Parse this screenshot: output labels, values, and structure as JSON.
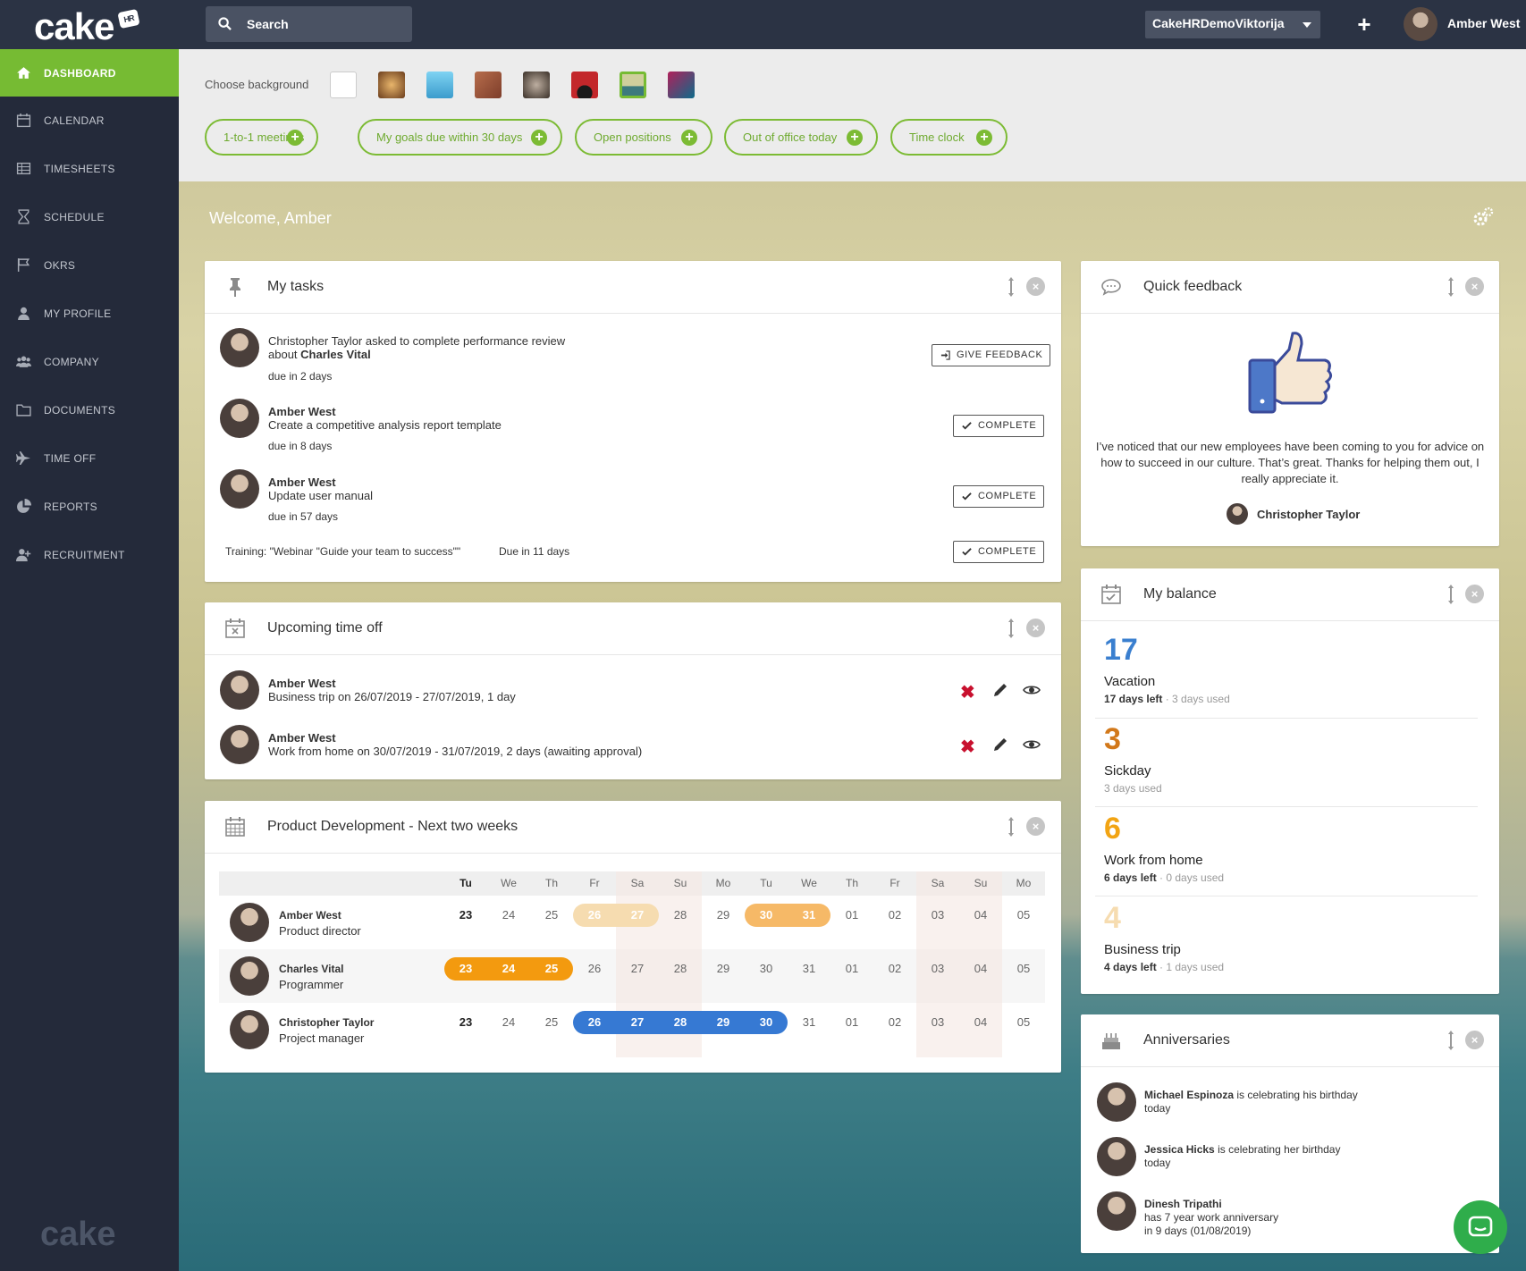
{
  "app": {
    "logo": "cake",
    "logo_badge": "HR"
  },
  "search": {
    "placeholder": "Search"
  },
  "account": {
    "name": "CakeHRDemoViktorija"
  },
  "user": {
    "name": "Amber West"
  },
  "sidebar": {
    "items": [
      {
        "label": "Dashboard",
        "icon": "home-icon",
        "active": true
      },
      {
        "label": "Calendar",
        "icon": "calendar-icon"
      },
      {
        "label": "Timesheets",
        "icon": "table-icon"
      },
      {
        "label": "Schedule",
        "icon": "hourglass-icon"
      },
      {
        "label": "OKRs",
        "icon": "flag-icon"
      },
      {
        "label": "My profile",
        "icon": "user-icon"
      },
      {
        "label": "Company",
        "icon": "users-icon"
      },
      {
        "label": "Documents",
        "icon": "folder-icon"
      },
      {
        "label": "Time off",
        "icon": "plane-icon"
      },
      {
        "label": "Reports",
        "icon": "pie-chart-icon"
      },
      {
        "label": "Recruitment",
        "icon": "user-plus-icon"
      }
    ],
    "footer_logo": "cake"
  },
  "background": {
    "label": "Choose background",
    "swatches": [
      "#ffffff",
      "#a86d3a",
      "#5cb7e0",
      "#a0563a",
      "#6b5a50",
      "#b6262a",
      "#8e9b55",
      "#1e6a7a"
    ],
    "selected": 6
  },
  "widgets_add": [
    "1-to-1 meetings",
    "My goals due within 30 days",
    "Open positions",
    "Out of office today",
    "Time clock"
  ],
  "welcome": "Welcome, Amber",
  "tasks": {
    "title": "My tasks",
    "items": [
      {
        "line1": "Christopher Taylor asked to complete performance review",
        "line2_pre": "about ",
        "line2_bold": "Charles Vital",
        "due": "due in 2 days",
        "button": "GIVE FEEDBACK"
      },
      {
        "name": "Amber West",
        "text": "Create a competitive analysis report template",
        "due": "due in 8 days",
        "button": "COMPLETE"
      },
      {
        "name": "Amber West",
        "text": "Update user manual",
        "due": "due in 57 days",
        "button": "COMPLETE"
      }
    ],
    "training": {
      "text": "Training: \"Webinar \"Guide your team to success\"\"",
      "due": "Due in 11 days",
      "button": "COMPLETE"
    }
  },
  "timeoff": {
    "title": "Upcoming time off",
    "items": [
      {
        "name": "Amber West",
        "text": "Business trip on 26/07/2019 - 27/07/2019, 1 day"
      },
      {
        "name": "Amber West",
        "text": "Work from home on 30/07/2019 - 31/07/2019, 2 days (awaiting approval)"
      }
    ]
  },
  "team": {
    "title": "Product Development - Next two weeks",
    "days": [
      "Tu",
      "We",
      "Th",
      "Fr",
      "Sa",
      "Su",
      "Mo",
      "Tu",
      "We",
      "Th",
      "Fr",
      "Sa",
      "Su",
      "Mo"
    ],
    "dates": [
      "23",
      "24",
      "25",
      "26",
      "27",
      "28",
      "29",
      "30",
      "31",
      "01",
      "02",
      "03",
      "04",
      "05"
    ],
    "members": [
      {
        "name": "Amber West",
        "role": "Product director"
      },
      {
        "name": "Charles Vital",
        "role": "Programmer"
      },
      {
        "name": "Christopher Taylor",
        "role": "Project manager"
      }
    ]
  },
  "feedback": {
    "title": "Quick feedback",
    "text": "I’ve noticed that our new employees have been coming to you for advice on how to succeed in our culture. That’s great. Thanks for helping them out, I really appreciate it.",
    "author": "Christopher Taylor"
  },
  "balance": {
    "title": "My balance",
    "items": [
      {
        "num": "17",
        "label": "Vacation",
        "left": "17 days left",
        "used": " · 3 days used",
        "color": "#3a7fcf"
      },
      {
        "num": "3",
        "label": "Sickday",
        "left": "",
        "used": "3 days used",
        "color": "#d2781a"
      },
      {
        "num": "6",
        "label": "Work from home",
        "left": "6 days left",
        "used": " · 0 days used",
        "color": "#f2a413"
      },
      {
        "num": "4",
        "label": "Business trip",
        "left": "4 days left",
        "used": " · 1 days used",
        "color": "#f6dcb0"
      }
    ]
  },
  "anniversaries": {
    "title": "Anniversaries",
    "items": [
      {
        "name": "Michael Espinoza",
        "text1": " is celebrating his birthday",
        "text2": "today"
      },
      {
        "name": "Jessica Hicks",
        "text1": " is celebrating her birthday",
        "text2": "today"
      },
      {
        "name": "Dinesh Tripathi",
        "text1": "",
        "text2": "has 7 year work anniversary",
        "text3": "in 9 days (01/08/2019)"
      }
    ]
  }
}
